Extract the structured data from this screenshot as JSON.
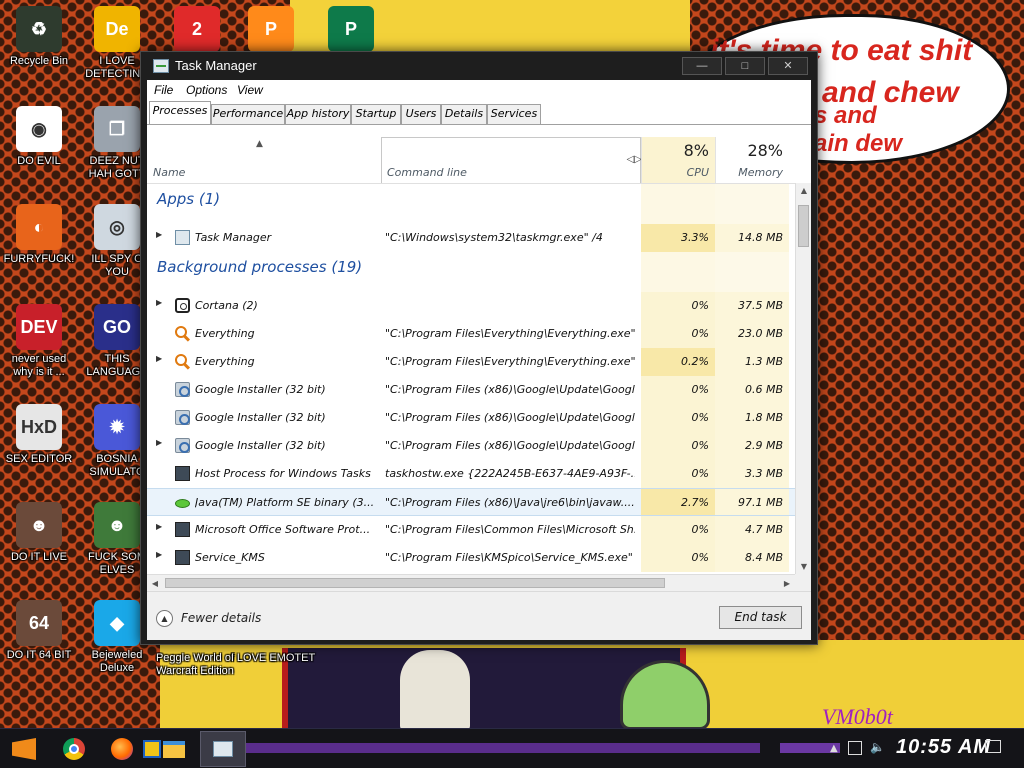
{
  "wallpaper": {
    "bubble_lines": [
      "it's time to eat shit",
      "and chew",
      "s and",
      "ain dew"
    ],
    "watermark": "VM0b0t"
  },
  "desktop_icons": [
    {
      "label": "Recycle Bin",
      "icon": "recycle-bin-icon",
      "color": "#2e3b2e",
      "glyph": "♻"
    },
    {
      "label": "I LOVE\nDETECTING",
      "icon": "detect-it-easy-icon",
      "color": "#f0b400",
      "glyph": "De"
    },
    {
      "label": "DO EVIL",
      "icon": "chrome-icon",
      "color": "#ffffff",
      "glyph": "◉"
    },
    {
      "label": "DEEZ NUT\nHAH GOTT",
      "icon": "windows-copy-icon",
      "color": "#9aa3ad",
      "glyph": "❐"
    },
    {
      "label": "FURRYFUCK!",
      "icon": "firefox-icon",
      "color": "#e8641b",
      "glyph": "◐"
    },
    {
      "label": "ILL SPY O\nYOU",
      "icon": "spy-camera-icon",
      "color": "#cfd8e0",
      "glyph": "◎"
    },
    {
      "label": "never used\nwhy is it ...",
      "icon": "dev-cpp-icon",
      "color": "#c8202a",
      "glyph": "DEV"
    },
    {
      "label": "THIS\nLANGUAGE",
      "icon": "goland-icon",
      "color": "#2a2f8a",
      "glyph": "GO"
    },
    {
      "label": "SEX EDITOR",
      "icon": "hxd-icon",
      "color": "#e6e6e6",
      "glyph": "HxD"
    },
    {
      "label": "BOSNIA\nSIMULATO",
      "icon": "mine-icon",
      "color": "#4a58d8",
      "glyph": "✹"
    },
    {
      "label": "DO IT LIVE",
      "icon": "portrait-icon",
      "color": "#6b4a3a",
      "glyph": "☻"
    },
    {
      "label": "FUCK SOM\nELVES",
      "icon": "elf-icon",
      "color": "#3f7a3a",
      "glyph": "☻"
    },
    {
      "label": "DO IT 64 BIT",
      "icon": "portrait-64-icon",
      "color": "#6b4a3a",
      "glyph": "64"
    },
    {
      "label": "Bejeweled\nDeluxe",
      "icon": "bejeweled-icon",
      "color": "#1aa8e8",
      "glyph": "◆"
    },
    {
      "label": "Peggle World of\nWarcraft Edition",
      "icon": "peggle-icon",
      "color": "#f6c21a",
      "glyph": "P"
    },
    {
      "label": "I LOVE EMOTET",
      "icon": "emotet-icon",
      "color": "#b21c7c",
      "glyph": "E"
    }
  ],
  "top_icons": [
    {
      "icon": "number-2-icon",
      "color": "#e02a2a",
      "glyph": "2"
    },
    {
      "icon": "peggle-top-icon",
      "color": "#ff8a1a",
      "glyph": "P"
    },
    {
      "icon": "publisher-icon",
      "color": "#0e7a4a",
      "glyph": "P"
    }
  ],
  "window": {
    "title": "Task Manager",
    "min": "—",
    "max": "□",
    "close": "✕",
    "menu": [
      "File",
      "Options",
      "View"
    ],
    "tabs": [
      "Processes",
      "Performance",
      "App history",
      "Startup",
      "Users",
      "Details",
      "Services"
    ],
    "active_tab": "Processes"
  },
  "columns": {
    "name": "Name",
    "command_line": "Command line",
    "cpu_label": "CPU",
    "cpu_total": "8%",
    "memory_label": "Memory",
    "memory_total": "28%",
    "sort_arrow": "▲",
    "resize_arrows": "◁▷"
  },
  "groups": {
    "apps": "Apps (1)",
    "background": "Background processes (19)"
  },
  "apps": [
    {
      "name": "Task Manager",
      "cmd": "\"C:\\Windows\\system32\\taskmgr.exe\" /4",
      "cpu": "3.3%",
      "mem": "14.8 MB",
      "icon": "task-manager-icon",
      "expand": true,
      "hot": true
    }
  ],
  "processes": [
    {
      "name": "Cortana (2)",
      "cmd": "",
      "cpu": "0%",
      "mem": "37.5 MB",
      "icon": "cortana-icon",
      "expand": true,
      "hot": false
    },
    {
      "name": "Everything",
      "cmd": "\"C:\\Program Files\\Everything\\Everything.exe\"...",
      "cpu": "0%",
      "mem": "23.0 MB",
      "icon": "everything-search-icon",
      "expand": false,
      "hot": false
    },
    {
      "name": "Everything",
      "cmd": "\"C:\\Program Files\\Everything\\Everything.exe\"...",
      "cpu": "0.2%",
      "mem": "1.3 MB",
      "icon": "everything-search-icon",
      "expand": true,
      "hot": true
    },
    {
      "name": "Google Installer (32 bit)",
      "cmd": "\"C:\\Program Files (x86)\\Google\\Update\\Googl...",
      "cpu": "0%",
      "mem": "0.6 MB",
      "icon": "google-installer-icon",
      "expand": false,
      "hot": false
    },
    {
      "name": "Google Installer (32 bit)",
      "cmd": "\"C:\\Program Files (x86)\\Google\\Update\\Googl...",
      "cpu": "0%",
      "mem": "1.8 MB",
      "icon": "google-installer-icon",
      "expand": false,
      "hot": false
    },
    {
      "name": "Google Installer (32 bit)",
      "cmd": "\"C:\\Program Files (x86)\\Google\\Update\\Googl...",
      "cpu": "0%",
      "mem": "2.9 MB",
      "icon": "google-installer-icon",
      "expand": true,
      "hot": false
    },
    {
      "name": "Host Process for Windows Tasks",
      "cmd": "taskhostw.exe {222A245B-E637-4AE9-A93F-...",
      "cpu": "0%",
      "mem": "3.3 MB",
      "icon": "host-process-icon",
      "expand": false,
      "hot": false
    },
    {
      "name": "Java(TM) Platform SE binary (3...",
      "cmd": "\"C:\\Program Files (x86)\\Java\\jre6\\bin\\javaw....",
      "cpu": "2.7%",
      "mem": "97.1 MB",
      "icon": "java-icon",
      "expand": false,
      "hot": true,
      "selected": true
    },
    {
      "name": "Microsoft Office Software Prot...",
      "cmd": "\"C:\\Program Files\\Common Files\\Microsoft Sh...",
      "cpu": "0%",
      "mem": "4.7 MB",
      "icon": "office-protection-icon",
      "expand": true,
      "hot": false
    },
    {
      "name": "Service_KMS",
      "cmd": "\"C:\\Program Files\\KMSpico\\Service_KMS.exe\"",
      "cpu": "0%",
      "mem": "8.4 MB",
      "icon": "service-kms-icon",
      "expand": true,
      "hot": false
    }
  ],
  "footer": {
    "fewer_details": "Fewer details",
    "end_task": "End task"
  },
  "taskbar": {
    "clock": "10:55 AM",
    "pinned": [
      "start-icon",
      "chrome-icon",
      "firefox-icon",
      "internet-explorer-icon",
      "file-explorer-icon",
      "task-manager-icon"
    ]
  }
}
